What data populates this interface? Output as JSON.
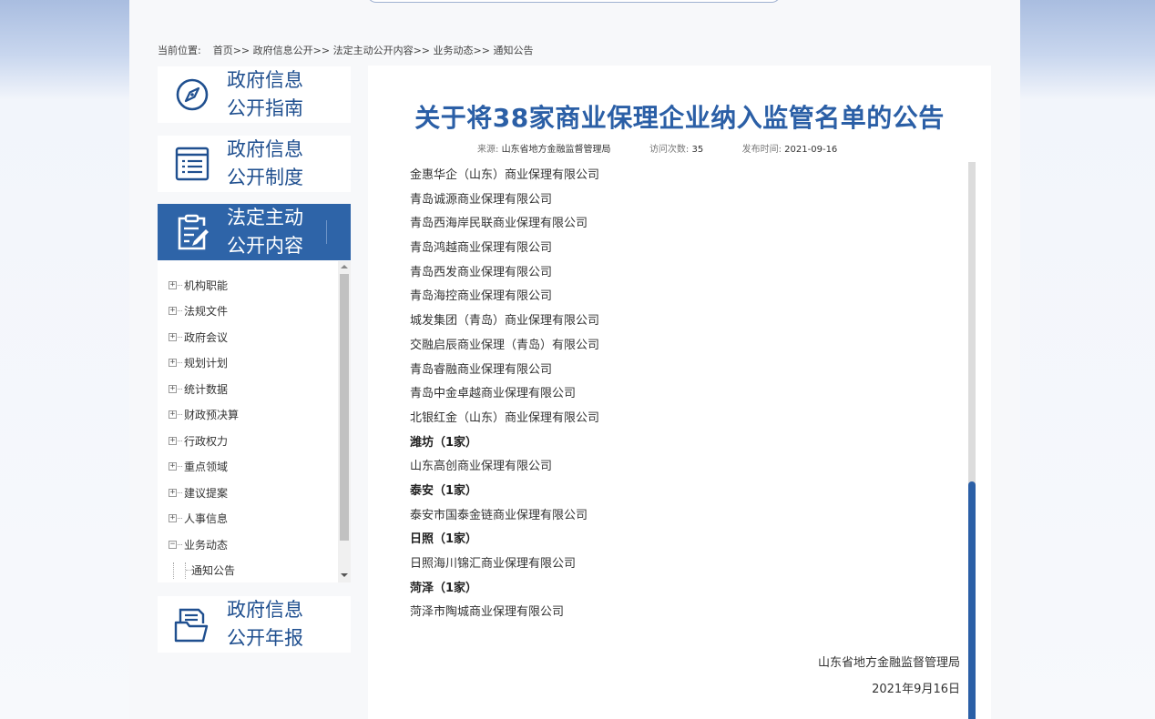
{
  "breadcrumb": {
    "prefix": "当前位置:",
    "items": [
      "首页>>",
      "政府信息公开>>",
      "法定主动公开内容>>",
      "业务动态>>",
      "通知公告"
    ]
  },
  "nav": [
    {
      "line1": "政府信息",
      "line2": "公开指南",
      "icon": "compass-icon"
    },
    {
      "line1": "政府信息",
      "line2": "公开制度",
      "icon": "list-document-icon"
    },
    {
      "line1": "法定主动",
      "line2": "公开内容",
      "icon": "clipboard-edit-icon"
    },
    {
      "line1": "政府信息",
      "line2": "公开年报",
      "icon": "report-folder-icon"
    }
  ],
  "tree": {
    "items": [
      "机构职能",
      "法规文件",
      "政府会议",
      "规划计划",
      "统计数据",
      "财政预决算",
      "行政权力",
      "重点领域",
      "建议提案",
      "人事信息",
      "业务动态"
    ],
    "expanded_child": "通知公告"
  },
  "article": {
    "title": "关于将38家商业保理企业纳入监管名单的公告",
    "meta": {
      "source_label": "来源:",
      "source": "山东省地方金融监督管理局",
      "visits_label": "访问次数:",
      "visits": "35",
      "date_label": "发布时间:",
      "date": "2021-09-16"
    },
    "lines": [
      {
        "text": "金惠华企（山东）商业保理有限公司",
        "bold": false
      },
      {
        "text": "青岛诚源商业保理有限公司",
        "bold": false
      },
      {
        "text": "青岛西海岸民联商业保理有限公司",
        "bold": false
      },
      {
        "text": "青岛鸿越商业保理有限公司",
        "bold": false
      },
      {
        "text": "青岛西发商业保理有限公司",
        "bold": false
      },
      {
        "text": "青岛海控商业保理有限公司",
        "bold": false
      },
      {
        "text": "城发集团（青岛）商业保理有限公司",
        "bold": false
      },
      {
        "text": "交融启辰商业保理（青岛）有限公司",
        "bold": false
      },
      {
        "text": "青岛睿融商业保理有限公司",
        "bold": false
      },
      {
        "text": "青岛中金卓越商业保理有限公司",
        "bold": false
      },
      {
        "text": "北银红金（山东）商业保理有限公司",
        "bold": false
      },
      {
        "text": "潍坊（1家）",
        "bold": true
      },
      {
        "text": "山东高创商业保理有限公司",
        "bold": false
      },
      {
        "text": "泰安（1家）",
        "bold": true
      },
      {
        "text": "泰安市国泰金链商业保理有限公司",
        "bold": false
      },
      {
        "text": "日照（1家）",
        "bold": true
      },
      {
        "text": "日照海川锦汇商业保理有限公司",
        "bold": false
      },
      {
        "text": "菏泽（1家）",
        "bold": true
      },
      {
        "text": "菏泽市陶城商业保理有限公司",
        "bold": false
      }
    ],
    "signature": "山东省地方金融监督管理局",
    "signature_date": "2021年9月16日"
  },
  "colors": {
    "brand_blue": "#2b5fa6",
    "active_nav": "#2e64a8"
  }
}
